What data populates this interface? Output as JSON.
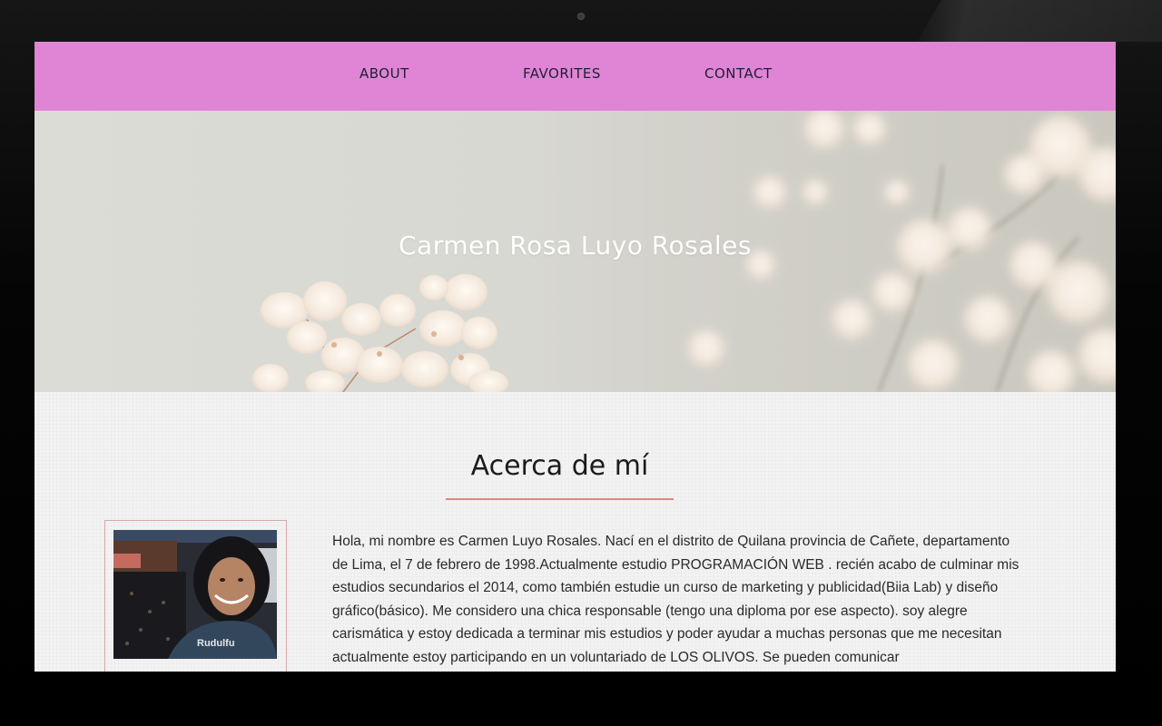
{
  "nav": {
    "items": [
      {
        "label": "About"
      },
      {
        "label": "Favorites"
      },
      {
        "label": "Contact"
      }
    ]
  },
  "hero": {
    "title": "Carmen Rosa Luyo Rosales"
  },
  "about": {
    "heading": "Acerca de mí",
    "bio": "Hola, mi nombre es Carmen Luyo Rosales. Nací en el distrito de Quilana provincia de Cañete, departamento de Lima, el 7 de febrero de 1998.Actualmente estudio PROGRAMACIÓN WEB . recién acabo de culminar mis estudios secundarios el 2014, como también estudie un curso de marketing y publicidad(Biia Lab) y diseño gráfico(básico). Me considero una chica responsable (tengo una diploma por ese aspecto). soy alegre carismática y estoy dedicada a terminar mis estudios y poder ayudar a muchas personas que me necesitan actualmente estoy participando en un voluntariado de LOS OLIVOS. Se pueden comunicar"
  },
  "colors": {
    "navbar": "#e084d6",
    "accent_underline": "#d9897d",
    "device_frame": "#000000"
  }
}
